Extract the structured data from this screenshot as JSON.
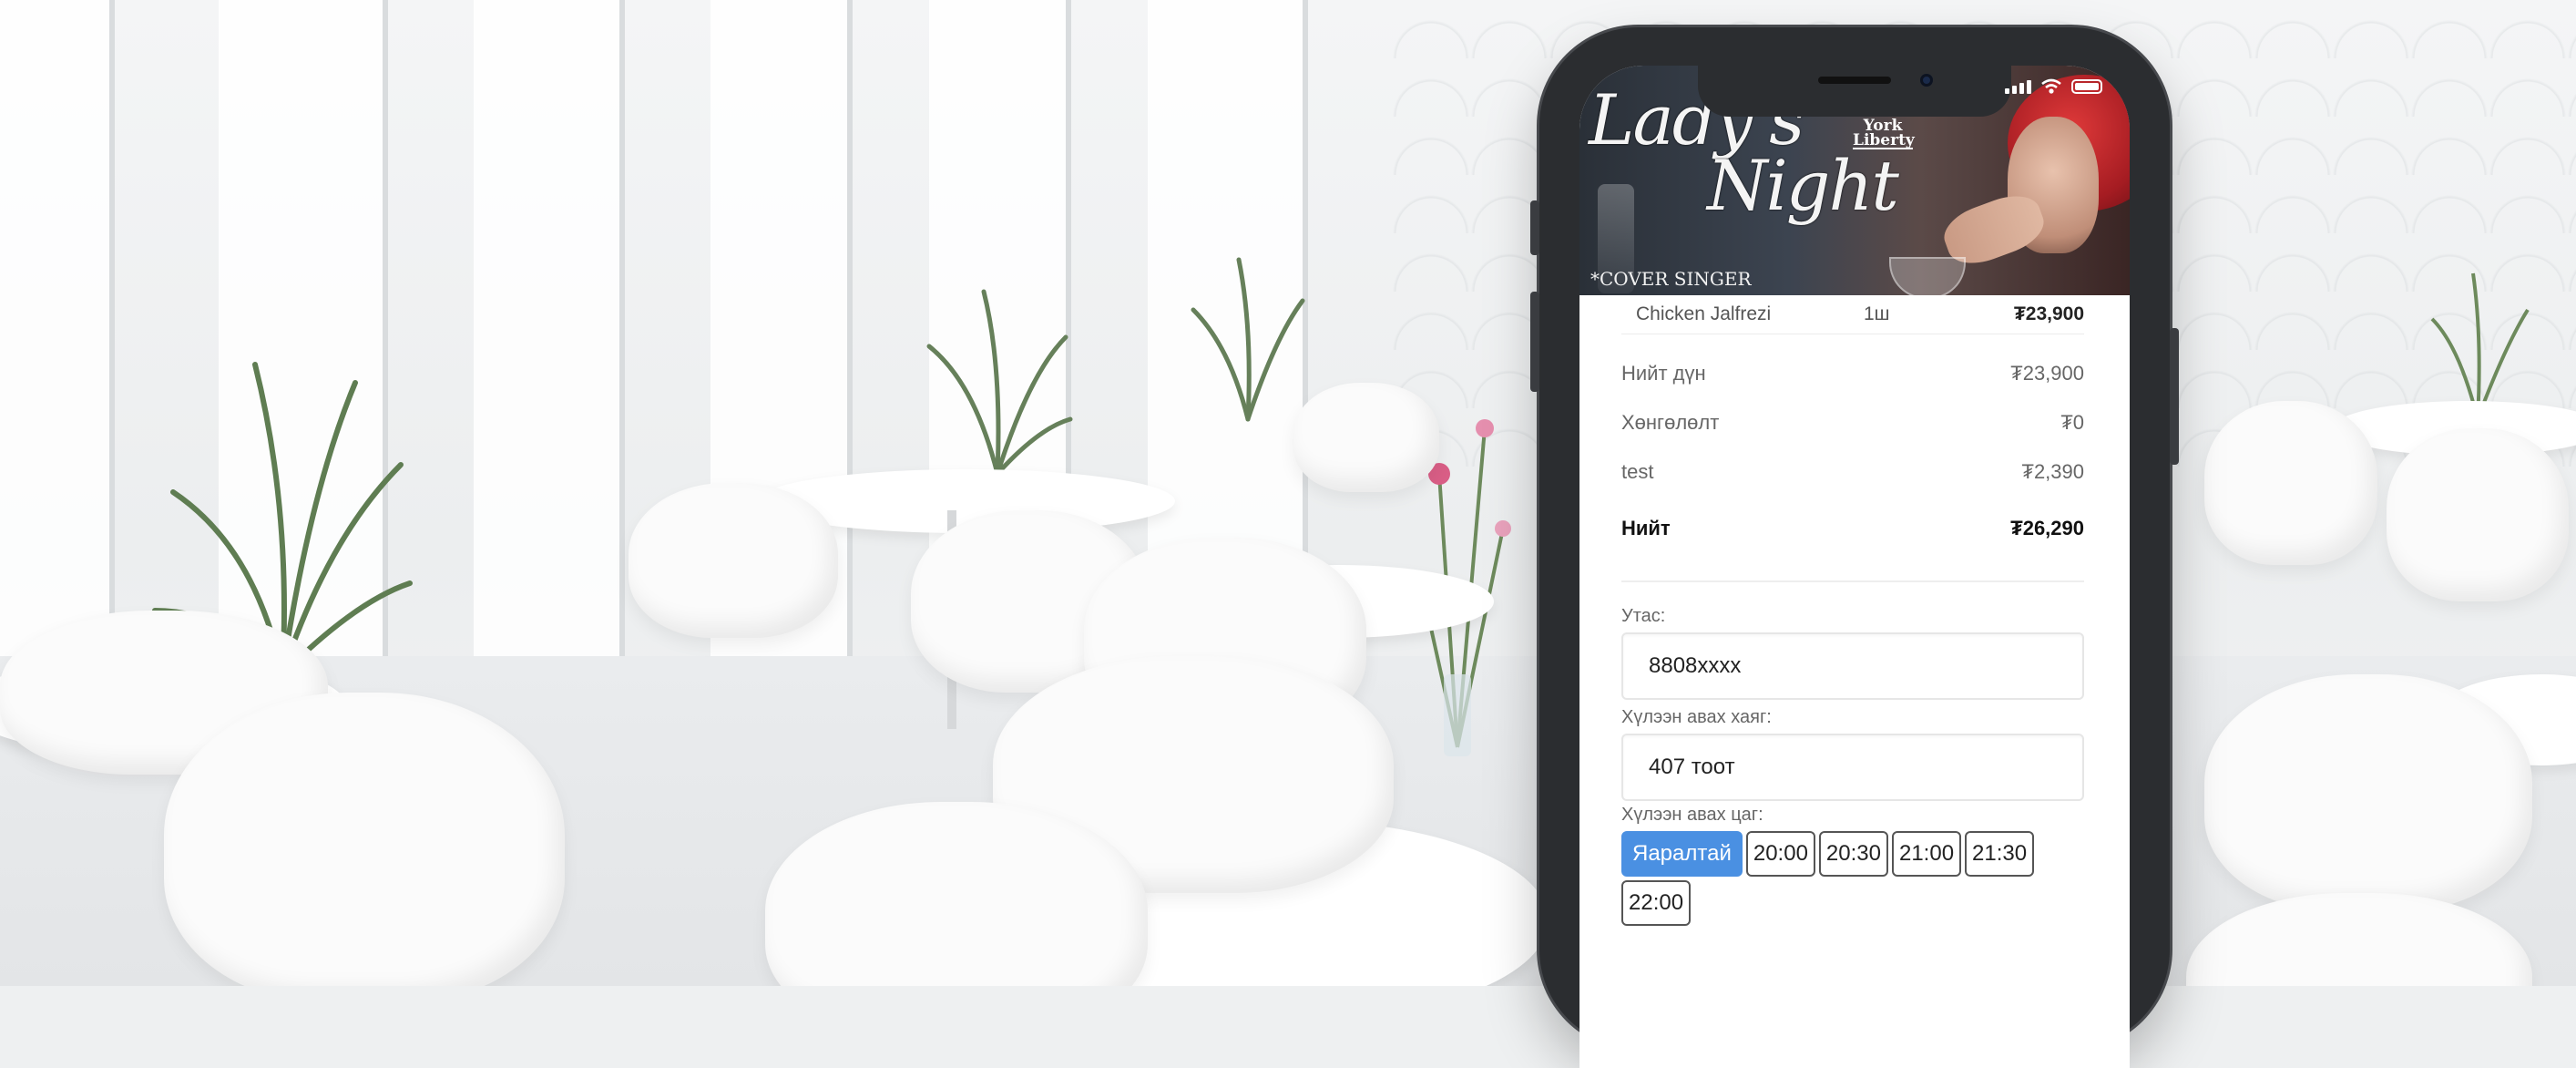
{
  "banner": {
    "title_line1": "Lady's",
    "title_line2": "Night",
    "logo_text": "New York Liberty",
    "subtitle": "*COVER SINGER"
  },
  "order": {
    "items": [
      {
        "name": "Chicken Jalfrezi",
        "qty": "1ш",
        "price": "₮23,900"
      }
    ],
    "summary": {
      "subtotal_label": "Нийт дүн",
      "subtotal_value": "₮23,900",
      "discount_label": "Хөнгөлөлт",
      "discount_value": "₮0",
      "fee_label": "test",
      "fee_value": "₮2,390",
      "total_label": "Нийт",
      "total_value": "₮26,290"
    }
  },
  "form": {
    "phone_label": "Утас:",
    "phone_value": "8808xxxx",
    "address_label": "Хүлээн авах хаяг:",
    "address_value": "407 тоот",
    "time_label": "Хүлээн авах цаг:",
    "time_options": [
      "Яаралтай",
      "20:00",
      "20:30",
      "21:00",
      "21:30",
      "22:00"
    ],
    "selected_time": "Яаралтай"
  },
  "colors": {
    "accent": "#4a90e2",
    "phone_frame": "#2b2d30"
  },
  "icons": {
    "status": [
      "signal-icon",
      "wifi-icon",
      "battery-icon"
    ]
  }
}
